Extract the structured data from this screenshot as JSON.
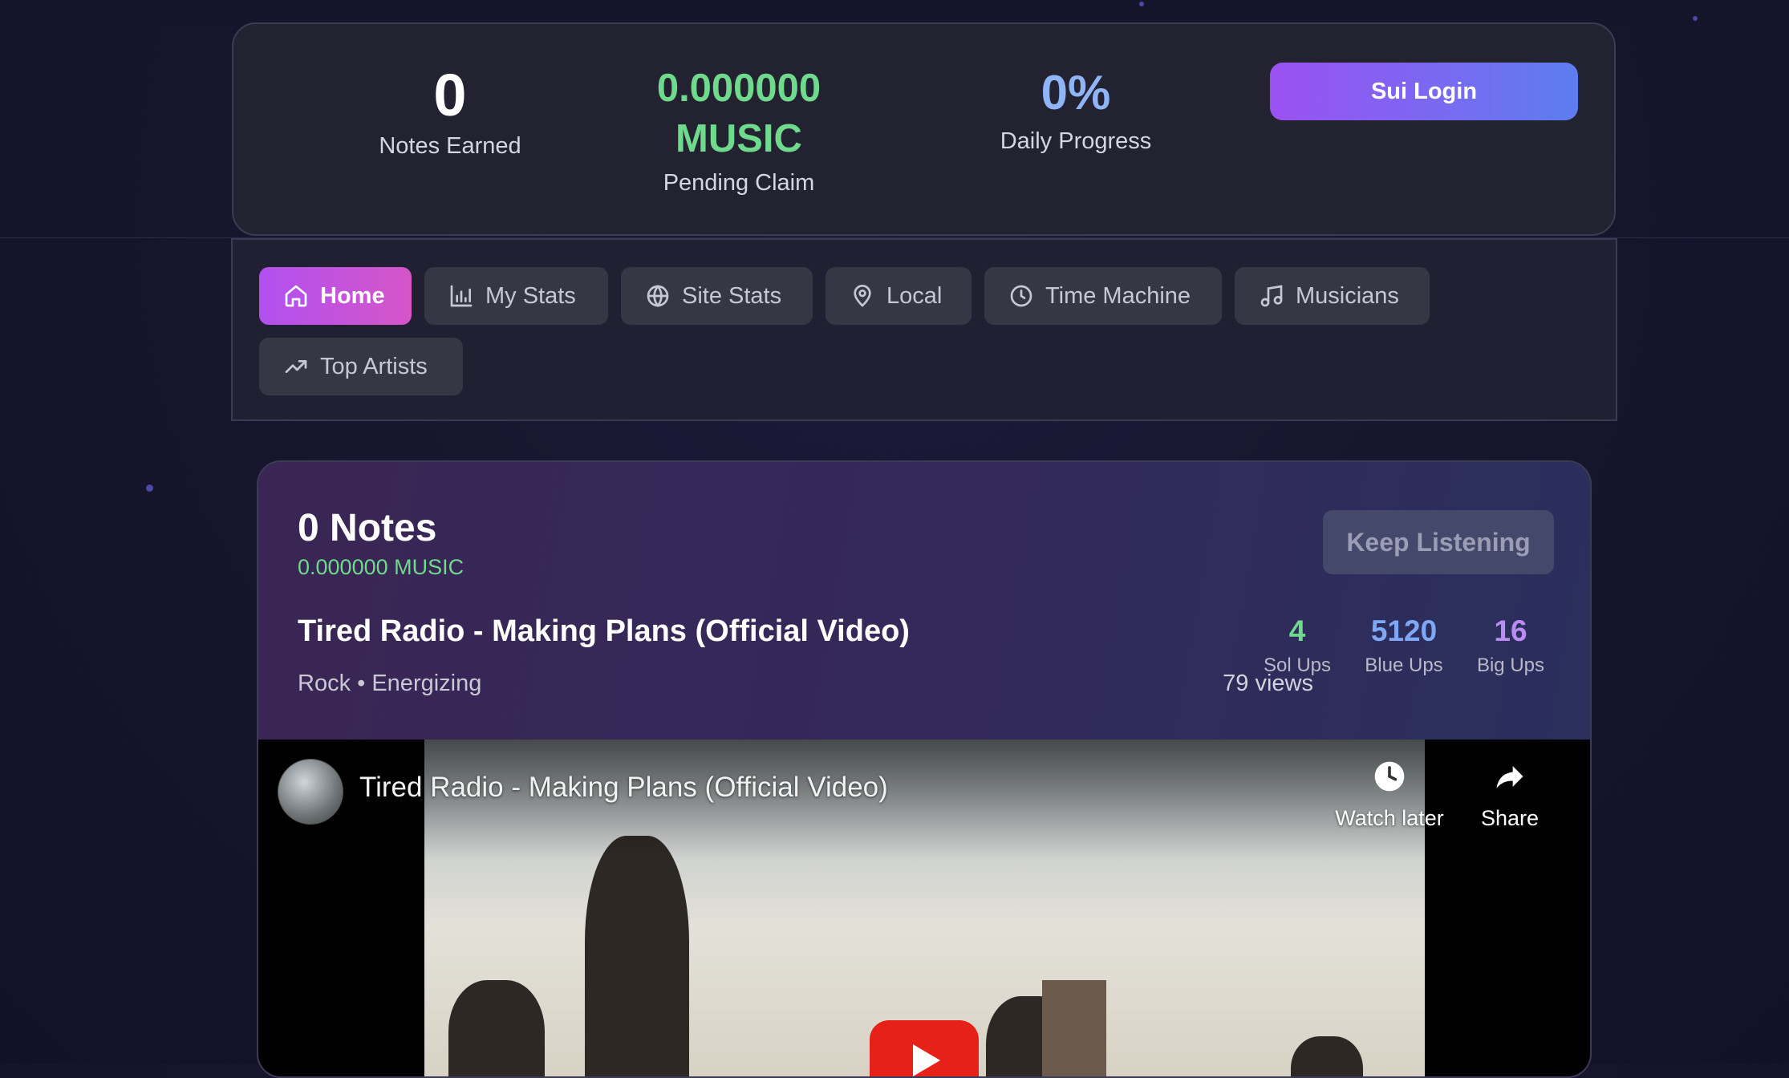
{
  "stats": {
    "notes_earned_value": "0",
    "notes_earned_label": "Notes Earned",
    "pending_value_line1": "0.000000",
    "pending_value_line2": "MUSIC",
    "pending_label": "Pending Claim",
    "daily_value": "0%",
    "daily_label": "Daily Progress",
    "login_label": "Sui Login"
  },
  "nav": {
    "items": [
      {
        "label": "Home",
        "icon": "home-icon",
        "active": true
      },
      {
        "label": "My Stats",
        "icon": "bar-chart-icon"
      },
      {
        "label": "Site Stats",
        "icon": "globe-icon"
      },
      {
        "label": "Local",
        "icon": "map-pin-icon"
      },
      {
        "label": "Time Machine",
        "icon": "clock-icon"
      },
      {
        "label": "Musicians",
        "icon": "music-note-icon"
      },
      {
        "label": "Top Artists",
        "icon": "trending-up-icon"
      }
    ]
  },
  "song": {
    "notes": "0 Notes",
    "music_amount": "0.000000 MUSIC",
    "keep_listening": "Keep Listening",
    "title": "Tired Radio - Making Plans (Official Video)",
    "tags": "Rock • Energizing",
    "views": "79 views",
    "ups": [
      {
        "value": "4",
        "label": "Sol Ups",
        "color": "#6fd98c"
      },
      {
        "value": "5120",
        "label": "Blue Ups",
        "color": "#7ea7f5"
      },
      {
        "value": "16",
        "label": "Big Ups",
        "color": "#b98cf2"
      }
    ]
  },
  "video": {
    "title": "Tired Radio - Making Plans (Official Video)",
    "watch_later": "Watch later",
    "share": "Share"
  },
  "colors": {
    "accent_purple": "#9b51f2",
    "accent_blue": "#5d7df0",
    "music_green": "#6fd98c",
    "percent_blue": "#8fb4f7"
  }
}
